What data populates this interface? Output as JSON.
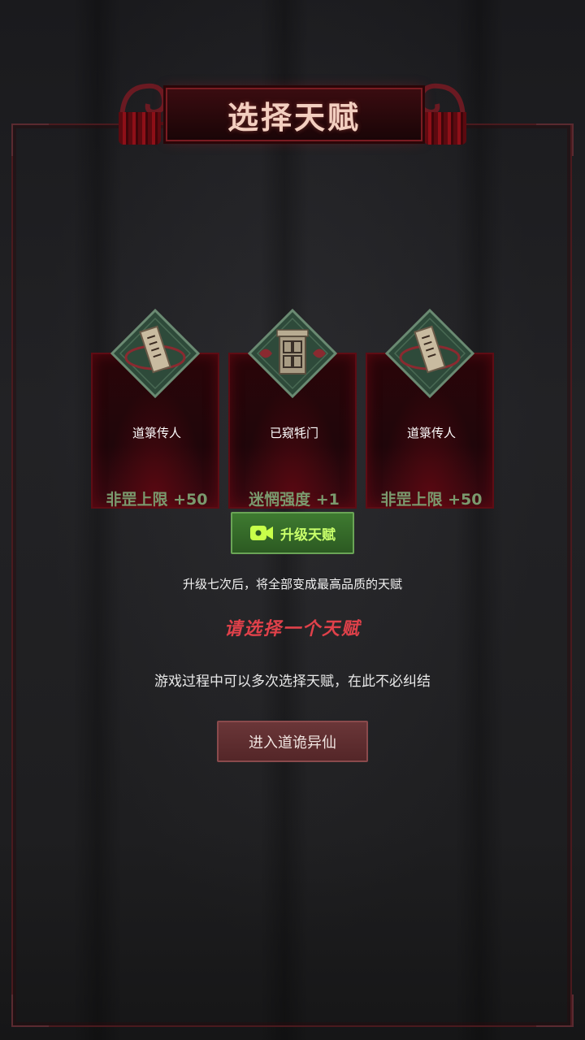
{
  "title": "选择天赋",
  "talents": [
    {
      "name": "道箓传人",
      "effect": "非罡上限 +50",
      "icon": "talisman-scroll-icon"
    },
    {
      "name": "已窥牦门",
      "effect": "迷惘强度 +1",
      "icon": "door-gate-icon"
    },
    {
      "name": "道箓传人",
      "effect": "非罡上限 +50",
      "icon": "talisman-scroll-icon"
    }
  ],
  "upgrade": {
    "label": "升级天赋",
    "icon": "video-camera-icon"
  },
  "hint": "升级七次后，将全部变成最高品质的天赋",
  "prompt": "请选择一个天赋",
  "info": "游戏过程中可以多次选择天赋，在此不必纠结",
  "enter_button": "进入道诡异仙",
  "colors": {
    "background": "#1c1c1e",
    "accent_red": "#e0414a",
    "effect_green": "#7a9a6e",
    "upgrade_green": "#c8ff6a",
    "card_red": "#2a0509"
  }
}
